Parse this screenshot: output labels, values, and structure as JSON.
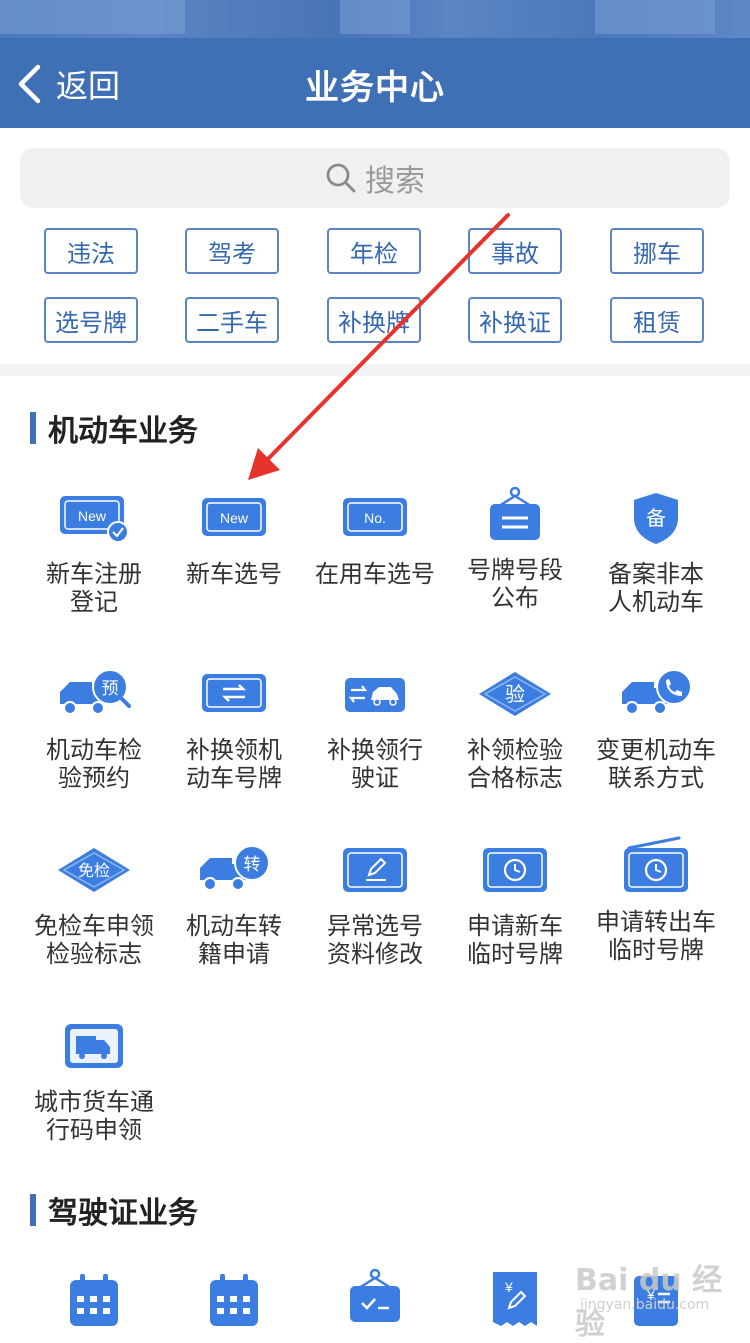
{
  "header": {
    "back_label": "返回",
    "title": "业务中心"
  },
  "search": {
    "placeholder": "搜索"
  },
  "quick_tags": [
    {
      "label": "违法"
    },
    {
      "label": "驾考"
    },
    {
      "label": "年检"
    },
    {
      "label": "事故"
    },
    {
      "label": "挪车"
    },
    {
      "label": "选号牌"
    },
    {
      "label": "二手车"
    },
    {
      "label": "补换牌"
    },
    {
      "label": "补换证"
    },
    {
      "label": "租赁"
    }
  ],
  "vehicle_section": {
    "title": "机动车业务",
    "items": [
      {
        "line1": "新车注册",
        "line2": "登记",
        "icon": "new-plate-check-icon"
      },
      {
        "line1": "新车选号",
        "line2": "",
        "icon": "new-plate-icon"
      },
      {
        "line1": "在用车选号",
        "line2": "",
        "icon": "no-plate-icon"
      },
      {
        "line1": "号牌号段",
        "line2": "公布",
        "icon": "hanging-sign-icon"
      },
      {
        "line1": "备案非本",
        "line2": "人机动车",
        "icon": "shield-icon"
      },
      {
        "line1": "机动车检",
        "line2": "验预约",
        "icon": "truck-appointment-icon"
      },
      {
        "line1": "补换领机",
        "line2": "动车号牌",
        "icon": "plate-exchange-icon"
      },
      {
        "line1": "补换领行",
        "line2": "驶证",
        "icon": "car-exchange-icon"
      },
      {
        "line1": "补领检验",
        "line2": "合格标志",
        "icon": "inspection-diamond-icon"
      },
      {
        "line1": "变更机动车",
        "line2": "联系方式",
        "icon": "truck-phone-icon"
      },
      {
        "line1": "免检车申领",
        "line2": "检验标志",
        "icon": "exempt-diamond-icon"
      },
      {
        "line1": "机动车转",
        "line2": "籍申请",
        "icon": "truck-transfer-icon"
      },
      {
        "line1": "异常选号",
        "line2": "资料修改",
        "icon": "edit-plate-icon"
      },
      {
        "line1": "申请新车",
        "line2": "临时号牌",
        "icon": "clock-plate-icon"
      },
      {
        "line1": "申请转出车",
        "line2": "临时号牌",
        "icon": "clock-radio-plate-icon"
      },
      {
        "line1": "城市货车通",
        "line2": "行码申领",
        "icon": "truck-pass-icon"
      }
    ],
    "icon_texts": {
      "new": "New",
      "no": "No.",
      "shield": "备",
      "yu": "预",
      "yan": "验",
      "mianjian": "免检",
      "zhuan": "转"
    }
  },
  "license_section": {
    "title": "驾驶证业务"
  },
  "watermark": {
    "text": "Bai du 经验",
    "sub": "jingyan.baidu.com"
  },
  "colors": {
    "brand": "#3f6fb4",
    "icon_blue": "#3b7de0",
    "annotation_red": "#e8322c"
  }
}
